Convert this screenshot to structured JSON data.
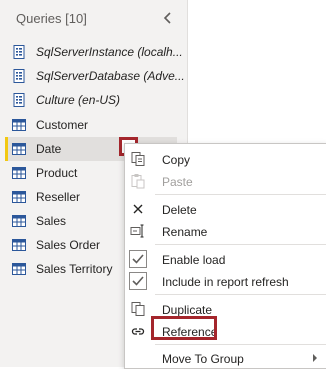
{
  "queries_pane": {
    "header": "Queries [10]",
    "items": [
      {
        "label": "SqlServerInstance (localh...",
        "kind": "parameter",
        "italic": true
      },
      {
        "label": "SqlServerDatabase (Adve...",
        "kind": "parameter",
        "italic": true
      },
      {
        "label": "Culture (en-US)",
        "kind": "parameter",
        "italic": true
      },
      {
        "label": "Customer",
        "kind": "table",
        "italic": false
      },
      {
        "label": "Date",
        "kind": "table",
        "italic": false,
        "selected": true
      },
      {
        "label": "Product",
        "kind": "table",
        "italic": false
      },
      {
        "label": "Reseller",
        "kind": "table",
        "italic": false
      },
      {
        "label": "Sales",
        "kind": "table",
        "italic": false
      },
      {
        "label": "Sales Order",
        "kind": "table",
        "italic": false
      },
      {
        "label": "Sales Territory",
        "kind": "table",
        "italic": false
      }
    ]
  },
  "context_menu": {
    "copy": "Copy",
    "paste": "Paste",
    "delete": "Delete",
    "rename": "Rename",
    "enable_load": "Enable load",
    "include_in_refresh": "Include in report refresh",
    "duplicate": "Duplicate",
    "reference": "Reference",
    "move_to_group": "Move To Group"
  },
  "colors": {
    "accent_selected": "#f2c811",
    "highlight_box": "#a4262c",
    "icon_blue": "#2b579a",
    "checkbox_check": "#605e5c"
  }
}
